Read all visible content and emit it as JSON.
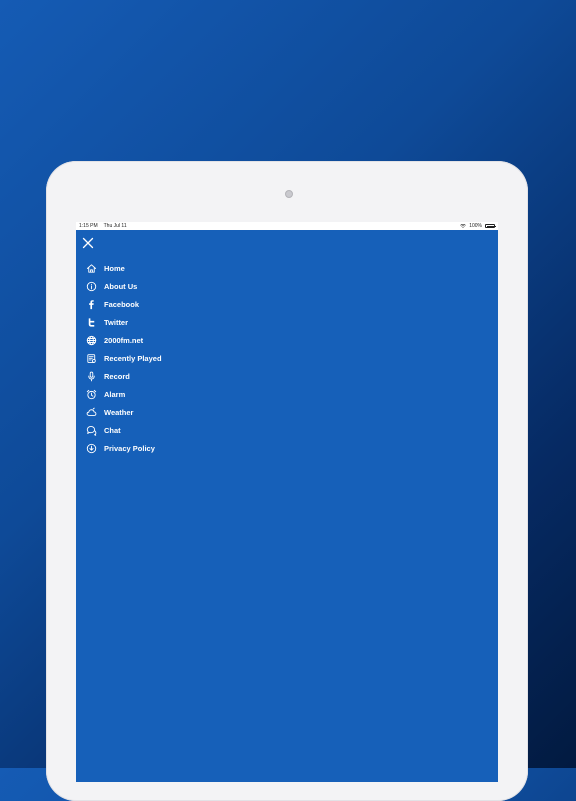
{
  "status_bar": {
    "time": "1:15 PM",
    "date": "Thu Jul 11",
    "battery": "100%"
  },
  "menu": {
    "items": [
      {
        "label": "Home",
        "icon": "home-icon"
      },
      {
        "label": "About Us",
        "icon": "info-icon"
      },
      {
        "label": "Facebook",
        "icon": "facebook-icon"
      },
      {
        "label": "Twitter",
        "icon": "twitter-icon"
      },
      {
        "label": "2000fm.net",
        "icon": "globe-icon"
      },
      {
        "label": "Recently Played",
        "icon": "playlist-icon"
      },
      {
        "label": "Record",
        "icon": "microphone-icon"
      },
      {
        "label": "Alarm",
        "icon": "alarm-icon"
      },
      {
        "label": "Weather",
        "icon": "weather-icon"
      },
      {
        "label": "Chat",
        "icon": "chat-icon"
      },
      {
        "label": "Privacy Policy",
        "icon": "privacy-icon"
      }
    ]
  },
  "colors": {
    "background": "#0e4a98",
    "menu_background": "#1660b9",
    "text": "#ffffff",
    "device_frame": "#f3f3f5"
  }
}
